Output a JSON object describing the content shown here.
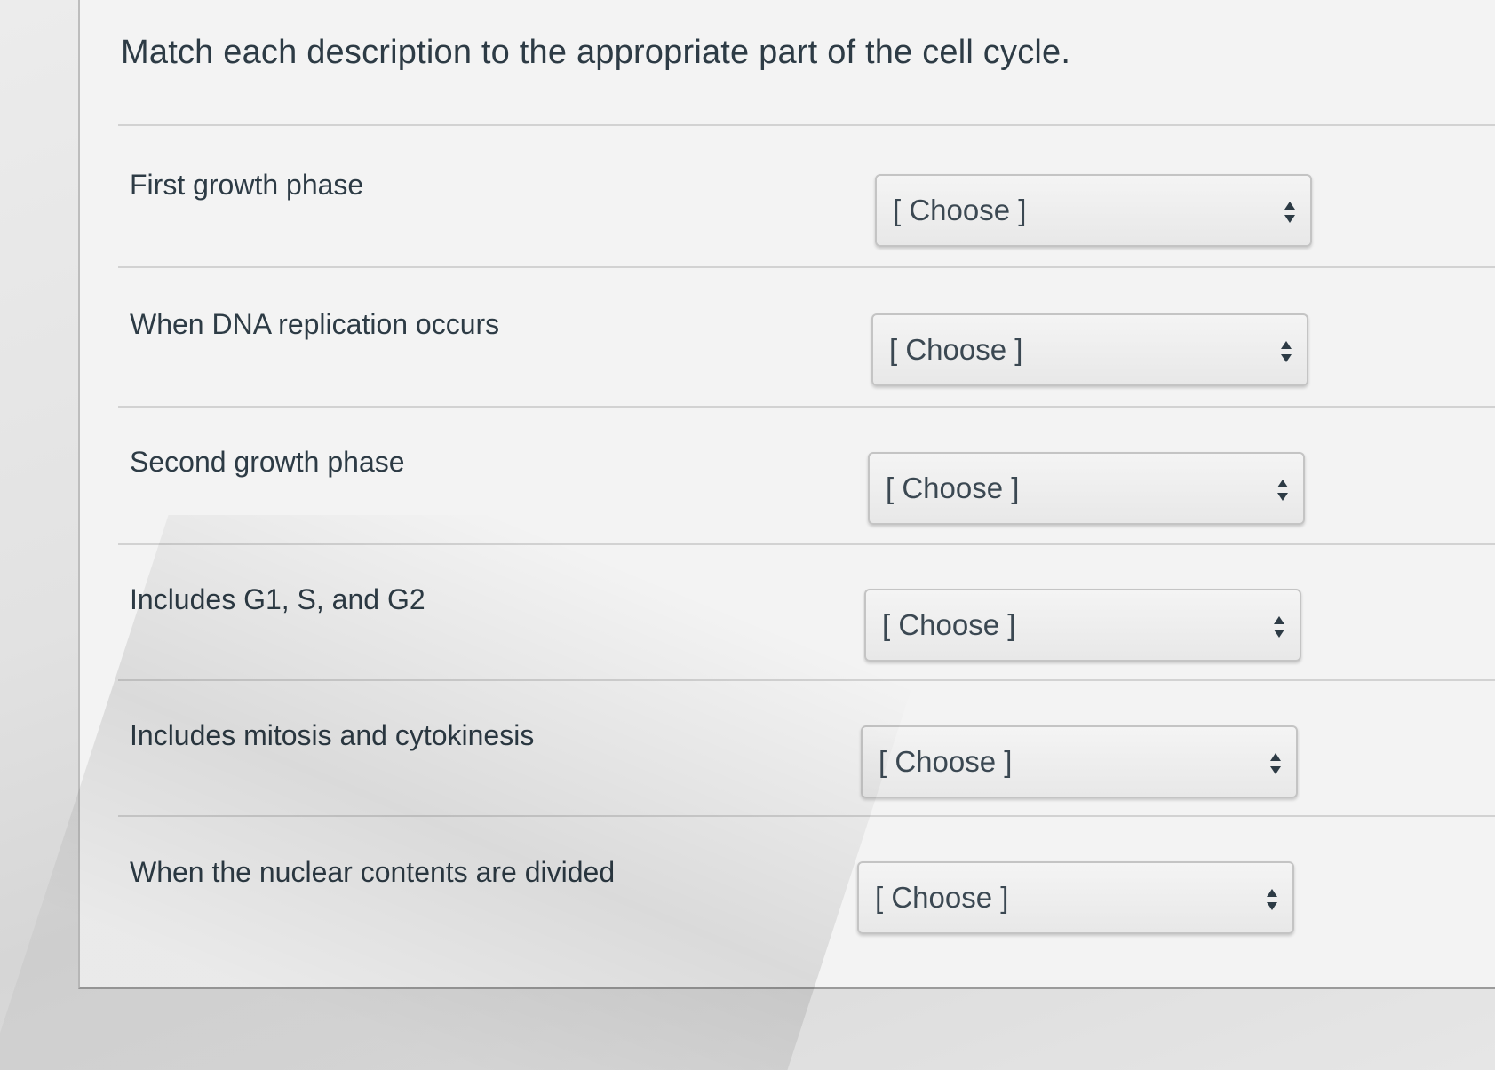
{
  "question": "Match each description to the appropriate part of the cell cycle.",
  "rows": [
    {
      "label": "First growth phase",
      "selected": "[ Choose ]"
    },
    {
      "label": "When DNA replication occurs",
      "selected": "[ Choose ]"
    },
    {
      "label": "Second growth phase",
      "selected": "[ Choose ]"
    },
    {
      "label": "Includes G1, S, and G2",
      "selected": "[ Choose ]"
    },
    {
      "label": "Includes mitosis and cytokinesis",
      "selected": "[ Choose ]"
    },
    {
      "label": "When the nuclear contents are divided",
      "selected": "[ Choose ]"
    }
  ],
  "icons": {
    "select_caret": "up-down-caret-icon"
  },
  "colors": {
    "text": "#2d3b45",
    "panel": "#f3f3f3",
    "select_border": "#c4c4c4"
  }
}
